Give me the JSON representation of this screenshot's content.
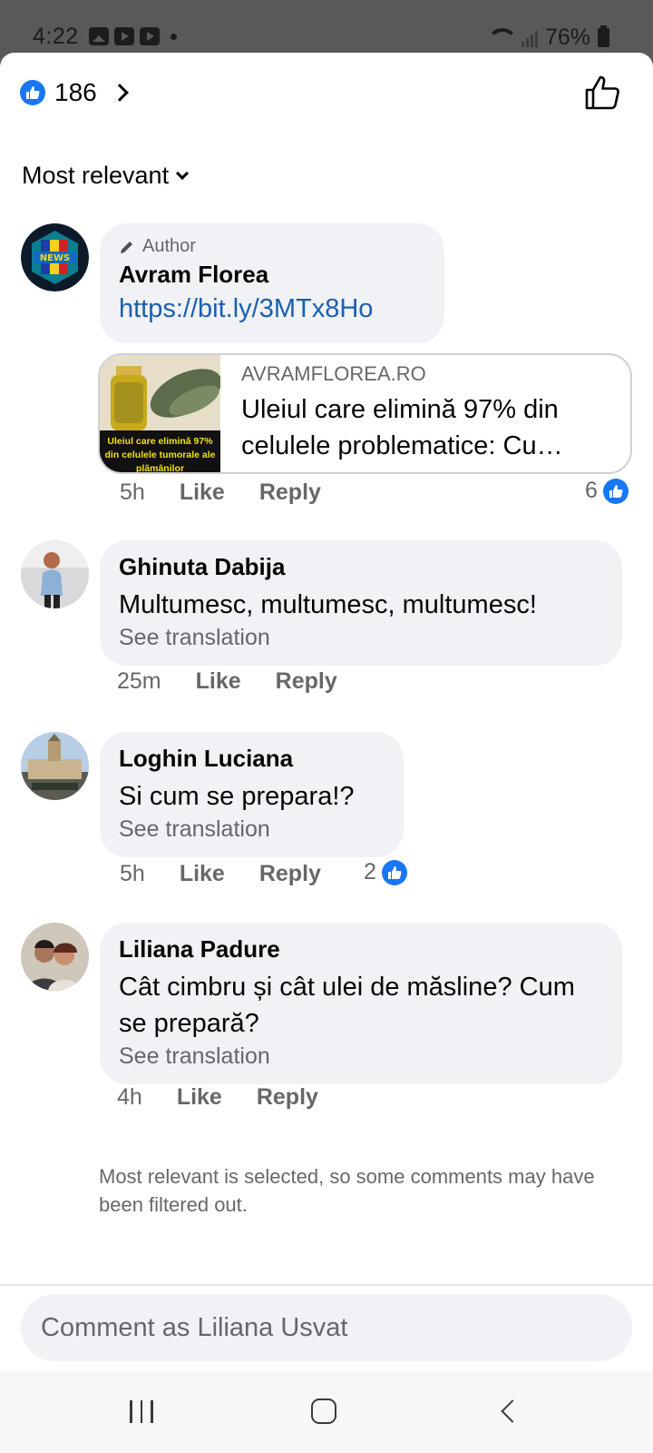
{
  "status_bar": {
    "time": "4:22",
    "battery": "76%"
  },
  "reactions": {
    "count": "186"
  },
  "sort": {
    "label": "Most relevant"
  },
  "comments": [
    {
      "author_badge": "Author",
      "name": "Avram Florea",
      "link": "https://bit.ly/3MTx8Ho",
      "preview": {
        "domain": "AVRAMFLOREA.RO",
        "title": "Uleiul care elimină 97% din celulele problematice: Cu…",
        "thumb_caption": "Uleiul care elimină 97% din celulele tumorale ale plămânilor"
      },
      "time": "5h",
      "like_label": "Like",
      "reply_label": "Reply",
      "reactions": "6"
    },
    {
      "name": "Ghinuta Dabija",
      "text": "Multumesc, multumesc, multumesc!",
      "see_translation": "See translation",
      "time": "25m",
      "like_label": "Like",
      "reply_label": "Reply"
    },
    {
      "name": "Loghin Luciana",
      "text": "Si cum se prepara!?",
      "see_translation": "See translation",
      "time": "5h",
      "like_label": "Like",
      "reply_label": "Reply",
      "reactions": "2"
    },
    {
      "name": "Liliana Padure",
      "text": "Cât cimbru și cât ulei de măsline? Cum se prepară?",
      "see_translation": "See translation",
      "time": "4h",
      "like_label": "Like",
      "reply_label": "Reply"
    }
  ],
  "filter_note": "Most relevant is selected, so some comments may have been filtered out.",
  "composer": {
    "placeholder": "Comment as Liliana Usvat"
  },
  "colors": {
    "accent": "#1877f2",
    "link": "#1b5fb1",
    "bubble": "#f0f2f5"
  }
}
